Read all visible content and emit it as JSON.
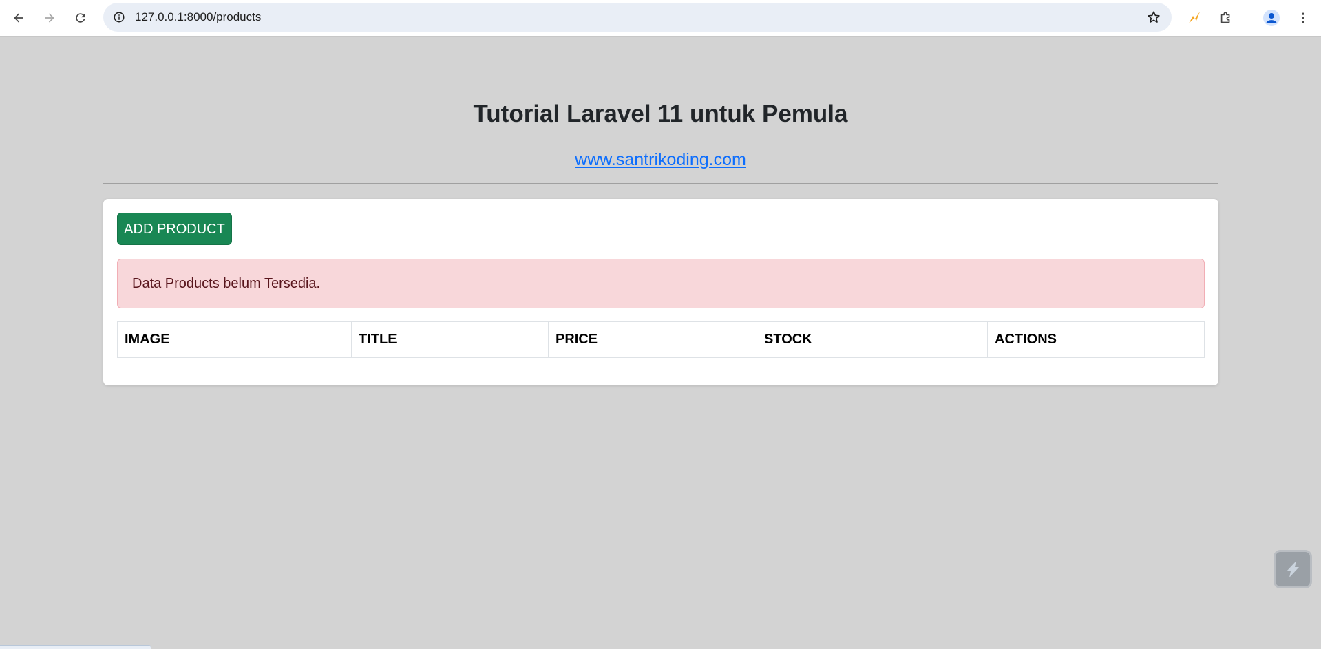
{
  "browser": {
    "url": "127.0.0.1:8000/products",
    "icons": {
      "back": "back-arrow-icon",
      "forward": "forward-arrow-icon",
      "reload": "reload-icon",
      "site_info": "info-icon",
      "bookmark": "star-icon",
      "extension_1": "lightning-extension-icon",
      "extensions": "puzzle-icon",
      "profile": "profile-icon",
      "menu": "kebab-menu-icon"
    }
  },
  "header": {
    "title": "Tutorial Laravel 11 untuk Pemula",
    "link": "www.santrikoding.com"
  },
  "card": {
    "add_button_label": "ADD PRODUCT",
    "alert_text": "Data Products belum Tersedia.",
    "table": {
      "columns": [
        "IMAGE",
        "TITLE",
        "PRICE",
        "STOCK",
        "ACTIONS"
      ]
    }
  },
  "colors": {
    "page_bg": "#d3d3d3",
    "success": "#198754",
    "danger_bg": "#f8d7da",
    "danger_text": "#58151c",
    "link": "#0d6efd"
  }
}
